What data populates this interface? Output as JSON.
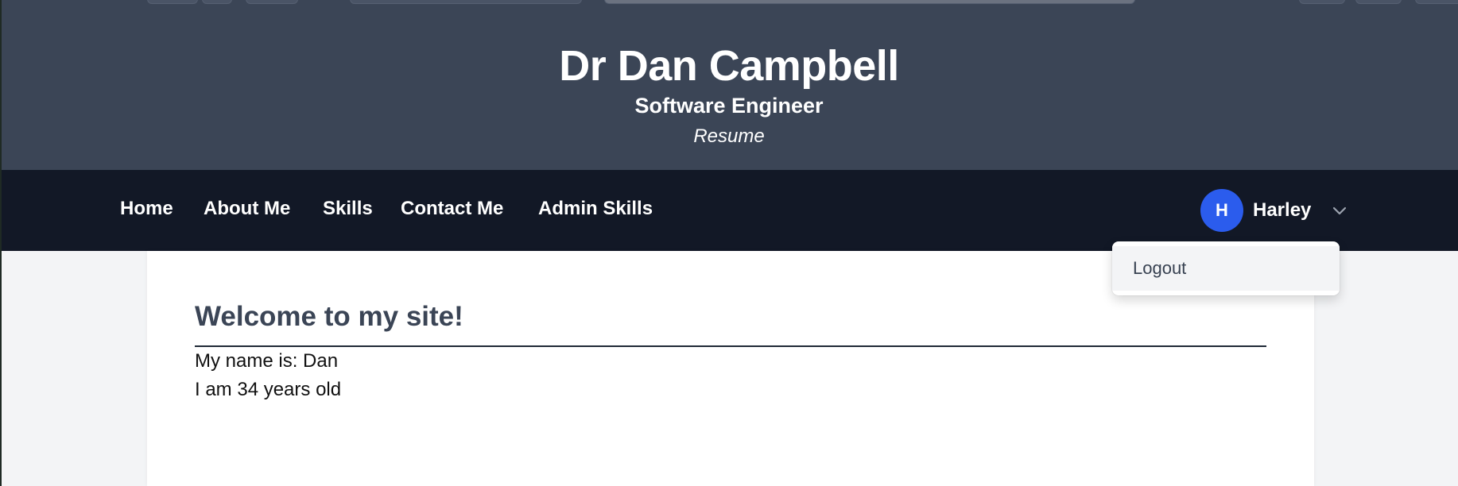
{
  "header": {
    "title": "Dr Dan Campbell",
    "subtitle": "Software Engineer",
    "tagline": "Resume"
  },
  "nav": {
    "items": [
      {
        "label": "Home"
      },
      {
        "label": "About Me"
      },
      {
        "label": "Skills"
      },
      {
        "label": "Contact Me"
      },
      {
        "label": "Admin Skills"
      }
    ]
  },
  "user": {
    "initial": "H",
    "name": "Harley",
    "avatar_color": "#2b5ced",
    "menu_icon": "chevron-down-icon"
  },
  "dropdown": {
    "items": [
      {
        "label": "Logout"
      }
    ]
  },
  "main": {
    "heading": "Welcome to my site!",
    "lines": [
      "My name is: Dan",
      "I am 34 years old"
    ]
  },
  "colors": {
    "header_bg": "#3b4556",
    "nav_bg": "#121826",
    "page_bg": "#f3f4f6",
    "card_bg": "#ffffff",
    "heading_color": "#3b4556"
  }
}
